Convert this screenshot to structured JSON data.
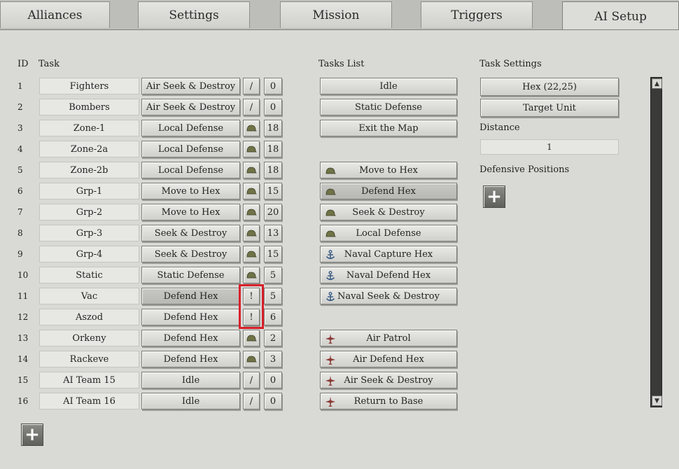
{
  "tabs": [
    {
      "label": "Alliances",
      "active": false
    },
    {
      "label": "Settings",
      "active": false
    },
    {
      "label": "Mission",
      "active": false
    },
    {
      "label": "Triggers",
      "active": false
    },
    {
      "label": "AI Setup",
      "active": true
    }
  ],
  "headers": {
    "id": "ID",
    "task": "Task",
    "tasks_list": "Tasks List",
    "task_settings": "Task Settings"
  },
  "rows": [
    {
      "id": "1",
      "name": "Fighters",
      "task": "Air Seek & Destroy",
      "icon": "slash",
      "count": "0"
    },
    {
      "id": "2",
      "name": "Bombers",
      "task": "Air Seek & Destroy",
      "icon": "slash",
      "count": "0"
    },
    {
      "id": "3",
      "name": "Zone-1",
      "task": "Local Defense",
      "icon": "helmet",
      "count": "18"
    },
    {
      "id": "4",
      "name": "Zone-2a",
      "task": "Local Defense",
      "icon": "helmet",
      "count": "18"
    },
    {
      "id": "5",
      "name": "Zone-2b",
      "task": "Local Defense",
      "icon": "helmet",
      "count": "18"
    },
    {
      "id": "6",
      "name": "Grp-1",
      "task": "Move to Hex",
      "icon": "helmet",
      "count": "15"
    },
    {
      "id": "7",
      "name": "Grp-2",
      "task": "Move to Hex",
      "icon": "helmet",
      "count": "20"
    },
    {
      "id": "8",
      "name": "Grp-3",
      "task": "Seek & Destroy",
      "icon": "helmet",
      "count": "13"
    },
    {
      "id": "9",
      "name": "Grp-4",
      "task": "Seek & Destroy",
      "icon": "helmet",
      "count": "15"
    },
    {
      "id": "10",
      "name": "Static",
      "task": "Static Defense",
      "icon": "helmet",
      "count": "5"
    },
    {
      "id": "11",
      "name": "Vac",
      "task": "Defend Hex",
      "icon": "exclaim",
      "count": "5",
      "selected": true
    },
    {
      "id": "12",
      "name": "Aszod",
      "task": "Defend Hex",
      "icon": "exclaim",
      "count": "6"
    },
    {
      "id": "13",
      "name": "Orkeny",
      "task": "Defend Hex",
      "icon": "helmet",
      "count": "2"
    },
    {
      "id": "14",
      "name": "Rackeve",
      "task": "Defend Hex",
      "icon": "helmet",
      "count": "3"
    },
    {
      "id": "15",
      "name": "AI Team 15",
      "task": "Idle",
      "icon": "slash",
      "count": "0"
    },
    {
      "id": "16",
      "name": "AI Team 16",
      "task": "Idle",
      "icon": "slash",
      "count": "0"
    }
  ],
  "tasks_list": [
    {
      "label": "Idle",
      "icon": "none",
      "slot": 0
    },
    {
      "label": "Static Defense",
      "icon": "none",
      "slot": 1
    },
    {
      "label": "Exit the Map",
      "icon": "none",
      "slot": 2
    },
    {
      "label": "Move to Hex",
      "icon": "helmet",
      "slot": 4
    },
    {
      "label": "Defend Hex",
      "icon": "helmet",
      "slot": 5,
      "selected": true
    },
    {
      "label": "Seek & Destroy",
      "icon": "helmet",
      "slot": 6
    },
    {
      "label": "Local Defense",
      "icon": "helmet",
      "slot": 7
    },
    {
      "label": "Naval Capture Hex",
      "icon": "anchor",
      "slot": 8
    },
    {
      "label": "Naval Defend Hex",
      "icon": "anchor",
      "slot": 9
    },
    {
      "label": "Naval Seek & Destroy",
      "icon": "anchor",
      "slot": 10
    },
    {
      "label": "Air Patrol",
      "icon": "plane",
      "slot": 12
    },
    {
      "label": "Air Defend Hex",
      "icon": "plane",
      "slot": 13
    },
    {
      "label": "Air Seek & Destroy",
      "icon": "plane",
      "slot": 14
    },
    {
      "label": "Return to Base",
      "icon": "plane",
      "slot": 15
    }
  ],
  "task_settings": {
    "hex_button": "Hex (22,25)",
    "target_unit_button": "Target Unit",
    "distance_label": "Distance",
    "distance_value": "1",
    "defensive_positions_label": "Defensive Positions"
  },
  "icons": {
    "slash": "/",
    "exclaim": "!"
  },
  "colors": {
    "helmet": "#6f7347",
    "anchor": "#3f5f86",
    "plane": "#8a3b36",
    "highlight": "#d8202a"
  }
}
